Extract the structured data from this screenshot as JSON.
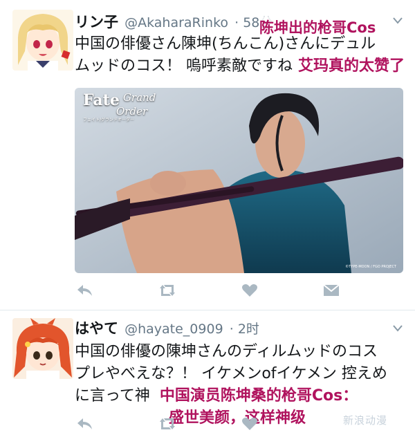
{
  "tweets": [
    {
      "display_name": "リン子",
      "handle": "@AkaharaRinko",
      "time": "· 58分",
      "text_lines": [
        "中国の俳優さん陳坤(ちんこん)さんにデュル",
        "ムッドのコス！ 嗚呼素敵ですね"
      ],
      "caption_top": "陈坤出的枪哥Cos",
      "caption_inline": "艾玛真的太赞了",
      "media": {
        "logo_main": "Fate",
        "logo_sub": "Grand",
        "logo_sub2": "Order",
        "logo_small": "フェイト/グランドオーダー",
        "credit": "©TYPE-MOON / FGO PROJECT"
      }
    },
    {
      "display_name": "はやて",
      "handle": "@hayate_0909",
      "time": "· 2时",
      "text_lines": [
        "中国の俳優の陳坤さんのディルムッドのコス",
        "プレやべえな？！ イケメンofイケメン 控えめ",
        "に言って神"
      ],
      "caption_line1": "中国演员陈坤桑的枪哥Cos：",
      "caption_line2": "盛世美颜，这样神级"
    }
  ],
  "icons": {
    "reply": "reply-icon",
    "retweet": "retweet-icon",
    "like": "heart-icon",
    "dm": "envelope-icon",
    "caret": "chevron-down-icon"
  },
  "colors": {
    "caption": "#b0135e",
    "action_icon": "#aab8c2",
    "handle": "#657786"
  },
  "watermark": "新浪动漫"
}
